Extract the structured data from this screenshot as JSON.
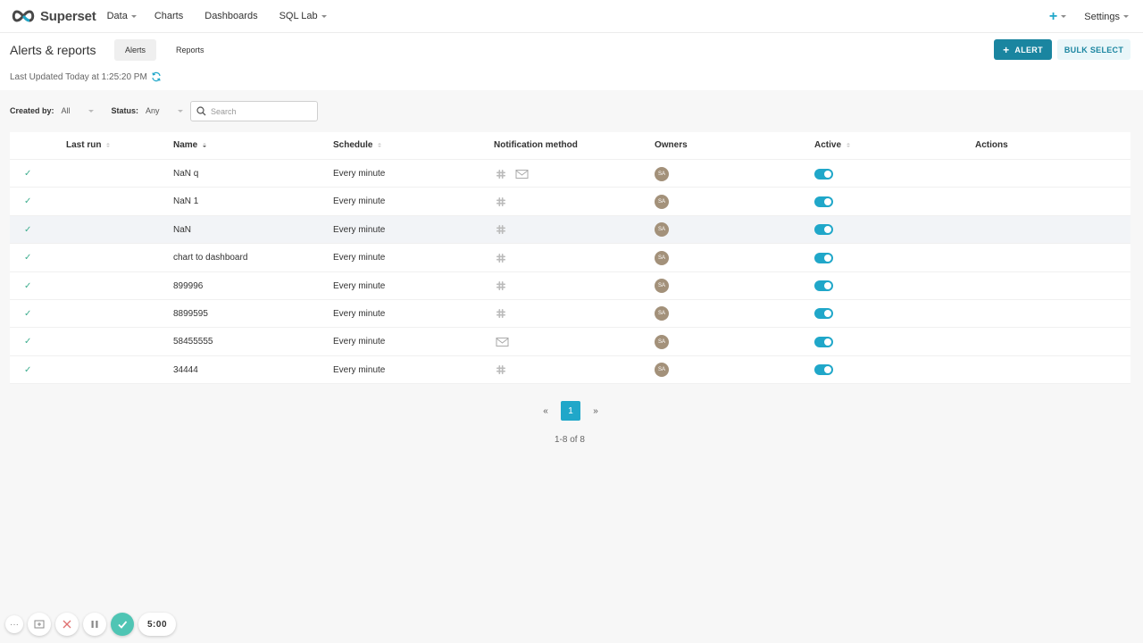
{
  "nav": {
    "brand": "Superset",
    "items": [
      {
        "label": "Data",
        "dropdown": true
      },
      {
        "label": "Charts",
        "dropdown": false
      },
      {
        "label": "Dashboards",
        "dropdown": false
      },
      {
        "label": "SQL Lab",
        "dropdown": true
      }
    ],
    "plus_label": "+",
    "settings_label": "Settings"
  },
  "header": {
    "title": "Alerts & reports",
    "tabs": [
      {
        "label": "Alerts",
        "active": true
      },
      {
        "label": "Reports",
        "active": false
      }
    ],
    "alert_button": "ALERT",
    "alert_button_icon": "+",
    "bulk_select_button": "BULK SELECT",
    "last_updated": "Last Updated Today at 1:25:20 PM"
  },
  "filters": {
    "created_by_label": "Created by:",
    "created_by_value": "All",
    "status_label": "Status:",
    "status_value": "Any",
    "search_placeholder": "Search"
  },
  "table": {
    "columns": [
      "Last run",
      "Name",
      "Schedule",
      "Notification method",
      "Owners",
      "Active",
      "Actions"
    ],
    "rows": [
      {
        "status": "✓",
        "name": "NaN q",
        "schedule": "Every minute",
        "methods": [
          "slack",
          "email"
        ],
        "owner": "SA",
        "active": true
      },
      {
        "status": "✓",
        "name": "NaN 1",
        "schedule": "Every minute",
        "methods": [
          "slack"
        ],
        "owner": "SA",
        "active": true
      },
      {
        "status": "✓",
        "name": "NaN",
        "schedule": "Every minute",
        "methods": [
          "slack"
        ],
        "owner": "SA",
        "active": true
      },
      {
        "status": "✓",
        "name": "chart to dashboard",
        "schedule": "Every minute",
        "methods": [
          "slack"
        ],
        "owner": "SA",
        "active": true
      },
      {
        "status": "✓",
        "name": "899996",
        "schedule": "Every minute",
        "methods": [
          "slack"
        ],
        "owner": "SA",
        "active": true
      },
      {
        "status": "✓",
        "name": "8899595",
        "schedule": "Every minute",
        "methods": [
          "slack"
        ],
        "owner": "SA",
        "active": true
      },
      {
        "status": "✓",
        "name": "58455555",
        "schedule": "Every minute",
        "methods": [
          "email"
        ],
        "owner": "SA",
        "active": true
      },
      {
        "status": "✓",
        "name": "34444",
        "schedule": "Every minute",
        "methods": [
          "slack"
        ],
        "owner": "SA",
        "active": true
      }
    ]
  },
  "pagination": {
    "prev": "«",
    "current": "1",
    "next": "»",
    "info": "1-8 of 8"
  },
  "recorder": {
    "more": "···",
    "time": "5:00"
  },
  "colors": {
    "primary": "#20a7c9",
    "primary_dark": "#1a85a0",
    "success": "#3fae8f",
    "avatar": "#a3917a"
  }
}
